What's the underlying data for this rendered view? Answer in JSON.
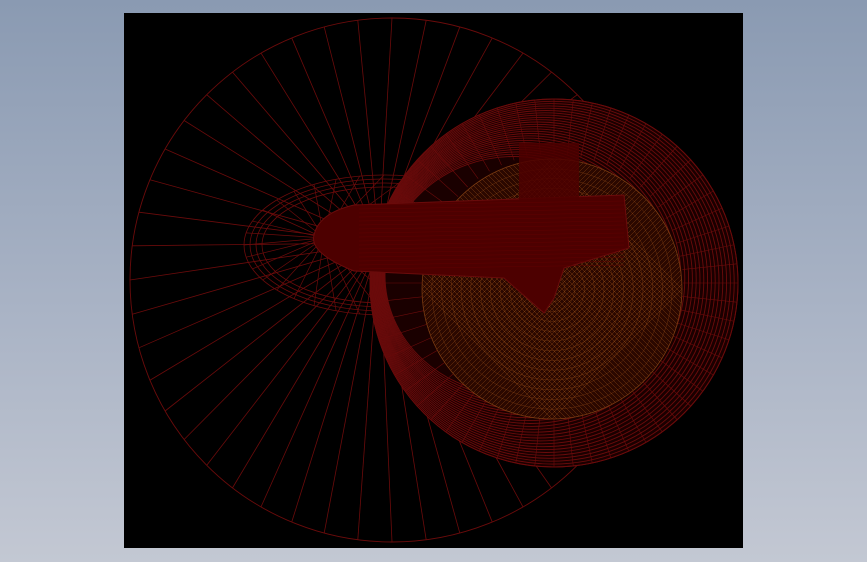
{
  "viewport": {
    "background": "#000000",
    "wire_color": "#6b0b0b",
    "fill_color": "#4d0000",
    "mesh_inner_color": "#7a3a10"
  },
  "wireframe": {
    "large_disc_spokes": 48,
    "cone_spokes": 36,
    "sphere_rings": 26,
    "mesh_rings": 40
  }
}
